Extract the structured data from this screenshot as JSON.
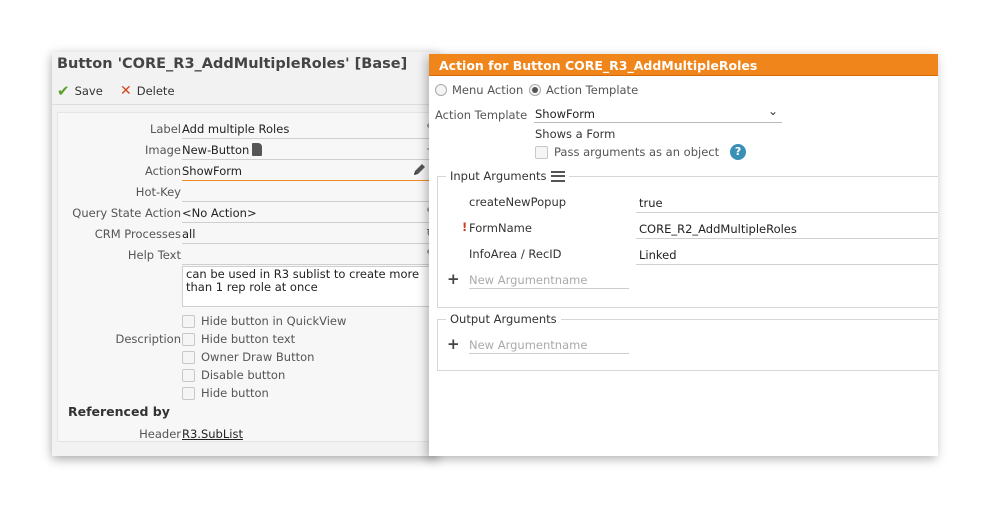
{
  "left": {
    "title": "Button 'CORE_R3_AddMultipleRoles' [Base]",
    "toolbar": {
      "save_label": "Save",
      "delete_label": "Delete"
    },
    "fields": {
      "label": {
        "label": "Label",
        "value": "Add multiple Roles"
      },
      "image": {
        "label": "Image",
        "value": "New-Button"
      },
      "action": {
        "label": "Action",
        "value": "ShowForm"
      },
      "hotkey": {
        "label": "Hot-Key",
        "value": ""
      },
      "query_state": {
        "label": "Query State Action",
        "value": "<No Action>"
      },
      "crm": {
        "label": "CRM Processes",
        "value": "all"
      },
      "help": {
        "label": "Help Text",
        "value": ""
      },
      "description": {
        "label": "Description",
        "value": "can be used in R3 sublist to create more than 1 rep role at once"
      }
    },
    "checkboxes": [
      "Hide button in QuickView",
      "Hide button text",
      "Owner Draw Button",
      "Disable button",
      "Hide button"
    ],
    "referenced_by": {
      "heading": "Referenced by",
      "label": "Header",
      "link": "R3.SubList"
    }
  },
  "right": {
    "title": "Action for Button CORE_R3_AddMultipleRoles",
    "radio": {
      "menu_action": "Menu Action",
      "action_template": "Action Template",
      "selected": "action_template"
    },
    "action_template": {
      "label": "Action Template",
      "value": "ShowForm"
    },
    "shows_form": "Shows a Form",
    "pass_args": "Pass arguments as an object",
    "input_args": {
      "legend": "Input Arguments",
      "rows": [
        {
          "name": "createNewPopup",
          "value": "true",
          "required": false
        },
        {
          "name": "FormName",
          "value": "CORE_R2_AddMultipleRoles",
          "required": true
        },
        {
          "name": "InfoArea / RecID",
          "value": "Linked",
          "required": false
        }
      ],
      "new_placeholder": "New Argumentname"
    },
    "output_args": {
      "legend": "Output Arguments",
      "new_placeholder": "New Argumentname"
    }
  },
  "colors": {
    "accent": "#f0851c",
    "save_green": "#5aa02c",
    "delete_red": "#d4491c",
    "help_blue": "#3a8fb7"
  }
}
